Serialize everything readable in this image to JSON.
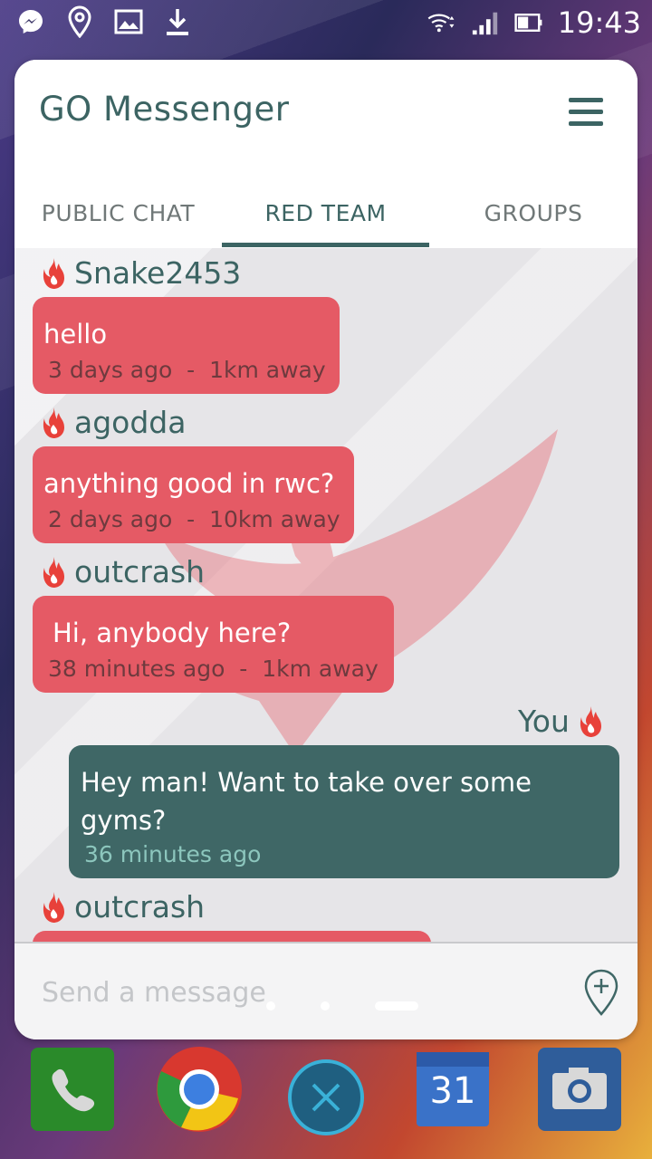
{
  "status_bar": {
    "time": "19:43",
    "icons": [
      "messenger-icon",
      "location-pin-icon",
      "image-icon",
      "download-icon",
      "wifi-icon",
      "signal-icon",
      "battery-icon"
    ]
  },
  "app": {
    "title": "GO Messenger",
    "menu_icon": "hamburger-menu-icon"
  },
  "tabs": [
    {
      "label": "PUBLIC CHAT",
      "active": false
    },
    {
      "label": "RED TEAM",
      "active": true
    },
    {
      "label": "GROUPS",
      "active": false
    }
  ],
  "messages": [
    {
      "sender": "Snake2453",
      "text": "hello",
      "meta": "3 days ago  -  1km away",
      "mine": false
    },
    {
      "sender": "agodda",
      "text": "anything good in rwc?",
      "meta": "2 days ago  -  10km away",
      "mine": false
    },
    {
      "sender": "outcrash",
      "text": "Hi, anybody here?",
      "meta": "38 minutes ago  -  1km away",
      "mine": false
    },
    {
      "sender": "You",
      "text": "Hey man! Want to take over some gyms?",
      "meta": "36 minutes ago",
      "mine": true
    },
    {
      "sender": "outcrash",
      "text": "",
      "meta": "",
      "mine": false
    }
  ],
  "composer": {
    "placeholder": "Send a message",
    "add_icon": "add-location-icon"
  },
  "dock": [
    "phone-app-icon",
    "chrome-app-icon",
    "close-app-icon",
    "calendar-app-icon",
    "camera-app-icon"
  ],
  "calendar_day": "31",
  "colors": {
    "primary": "#3f6766",
    "red_bubble": "#e55a65",
    "flame": "#e8413a"
  }
}
